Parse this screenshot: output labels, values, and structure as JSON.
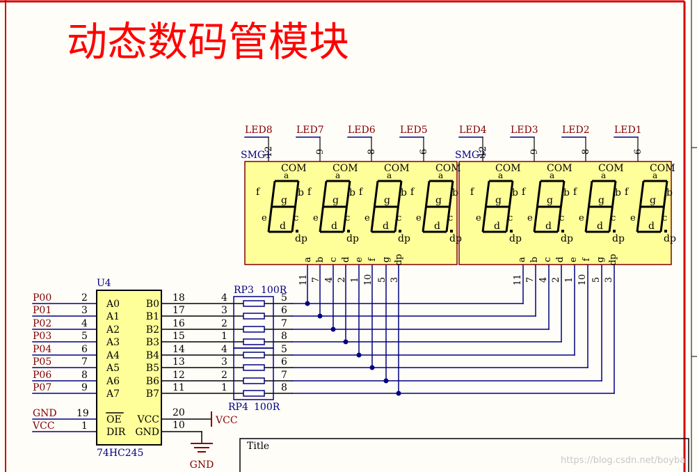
{
  "title": "动态数码管模块",
  "watermark": "https://blog.csdn.net/boyba",
  "title_block_label": "Title",
  "colors": {
    "border": "#d40000",
    "title": "#ff0000",
    "wire": "#000080",
    "net_label": "#800000",
    "symbol_fill": "#ffff99",
    "symbol_stroke": "#800000",
    "text": "#000000",
    "component_label": "#000080"
  },
  "displays": [
    {
      "designator": "SMG1",
      "com_labels": [
        "LED8",
        "LED7",
        "LED6",
        "LED5"
      ],
      "com_pins": [
        "12",
        "9",
        "8",
        "6"
      ]
    },
    {
      "designator": "SMG2",
      "com_labels": [
        "LED4",
        "LED3",
        "LED2",
        "LED1"
      ],
      "com_pins": [
        "12",
        "9",
        "8",
        "6"
      ]
    }
  ],
  "digit_labels": {
    "com": "COM",
    "a": "a",
    "b": "b",
    "c": "c",
    "d": "d",
    "e": "e",
    "f": "f",
    "g": "g",
    "dp": "dp"
  },
  "segment_pins": {
    "names": [
      "a",
      "b",
      "c",
      "d",
      "e",
      "f",
      "g",
      "dp"
    ],
    "numbers": [
      "11",
      "7",
      "4",
      "2",
      "1",
      "10",
      "5",
      "3"
    ]
  },
  "ic": {
    "designator": "U4",
    "part": "74HC245",
    "a_pins": [
      {
        "net": "P00",
        "num": "2",
        "name": "A0"
      },
      {
        "net": "P01",
        "num": "3",
        "name": "A1"
      },
      {
        "net": "P02",
        "num": "4",
        "name": "A2"
      },
      {
        "net": "P03",
        "num": "5",
        "name": "A3"
      },
      {
        "net": "P04",
        "num": "6",
        "name": "A4"
      },
      {
        "net": "P05",
        "num": "7",
        "name": "A5"
      },
      {
        "net": "P06",
        "num": "8",
        "name": "A6"
      },
      {
        "net": "P07",
        "num": "9",
        "name": "A7"
      }
    ],
    "b_pins": [
      {
        "num": "18",
        "name": "B0"
      },
      {
        "num": "17",
        "name": "B1"
      },
      {
        "num": "16",
        "name": "B2"
      },
      {
        "num": "15",
        "name": "B3"
      },
      {
        "num": "14",
        "name": "B4"
      },
      {
        "num": "13",
        "name": "B5"
      },
      {
        "num": "12",
        "name": "B6"
      },
      {
        "num": "11",
        "name": "B7"
      }
    ],
    "oe": {
      "net": "GND",
      "num": "19",
      "name": "OE"
    },
    "dir": {
      "net": "VCC",
      "num": "1",
      "name": "DIR"
    },
    "vcc": {
      "num": "20",
      "name": "VCC",
      "net": "VCC"
    },
    "gnd": {
      "num": "10",
      "name": "GND",
      "net": "GND"
    }
  },
  "resistor_arrays": [
    {
      "designator": "RP3",
      "value": "100R",
      "left_pins": [
        "4",
        "3",
        "2",
        "1"
      ],
      "right_pins": [
        "5",
        "6",
        "7",
        "8"
      ]
    },
    {
      "designator": "RP4",
      "value": "100R",
      "left_pins": [
        "4",
        "3",
        "2",
        "1"
      ],
      "right_pins": [
        "5",
        "6",
        "7",
        "8"
      ]
    }
  ]
}
